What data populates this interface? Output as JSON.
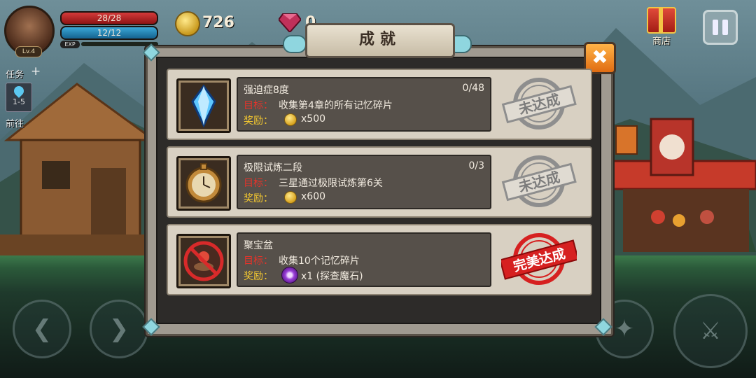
{
  "hud": {
    "level": "Lv.4",
    "hp": "28/28",
    "mp": "12/12",
    "exp_label": "EXP",
    "gold": "726",
    "gems": "0",
    "shop_label": "商店",
    "task_label": "任务",
    "task_stage": "1-5",
    "goto_label": "前往"
  },
  "dialog": {
    "title": "成就",
    "close_icon": "close-x-icon"
  },
  "achievements": [
    {
      "name": "强迫症8度",
      "progress": "0/48",
      "goal_label": "目标：",
      "goal": "收集第4章的所有记忆碎片",
      "reward_label": "奖励：",
      "reward_icon": "coin-icon",
      "reward": "x500",
      "icon": "blue-crystal-icon",
      "stamp": "未达成",
      "stamp_color": "#8e8e8e"
    },
    {
      "name": "极限试炼二段",
      "progress": "0/3",
      "goal_label": "目标：",
      "goal": "三星通过极限试炼第6关",
      "reward_label": "奖励：",
      "reward_icon": "coin-icon",
      "reward": "x600",
      "icon": "pocket-watch-icon",
      "stamp": "未达成",
      "stamp_color": "#8e8e8e"
    },
    {
      "name": "聚宝盆",
      "progress": "",
      "goal_label": "目标：",
      "goal": "收集10个记忆碎片",
      "reward_label": "奖励：",
      "reward_icon": "eye-stone-icon",
      "reward": "x1 (探查魔石)",
      "icon": "forbidden-treasure-bowl-icon",
      "stamp": "完美达成",
      "stamp_color": "#d62020"
    }
  ]
}
